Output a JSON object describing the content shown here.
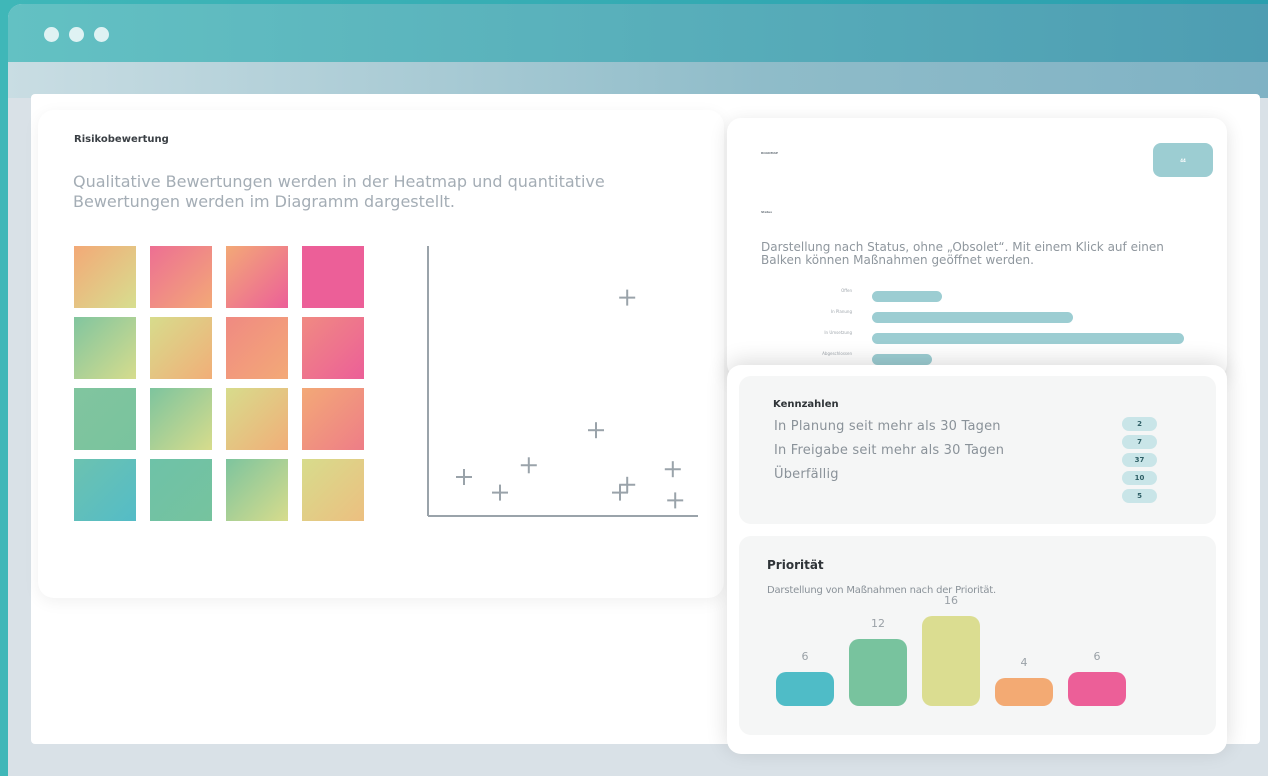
{
  "window": {
    "dots": [
      "dot",
      "dot",
      "dot"
    ]
  },
  "risk": {
    "title": "Risikobewertung",
    "description": "Qualitative Bewertungen werden in der Heatmap und quantitative Bewertungen werden im Diagramm dargestellt.",
    "heatmap_icon": "heatmap-grid",
    "scatter": {
      "type": "scatter",
      "points": [
        [
          1.5,
          1.0
        ],
        [
          3.0,
          0.6
        ],
        [
          4.2,
          1.3
        ],
        [
          7.0,
          2.2
        ],
        [
          8.3,
          5.6
        ],
        [
          8.0,
          0.6
        ],
        [
          8.3,
          0.8
        ],
        [
          10.2,
          1.2
        ],
        [
          10.3,
          0.4
        ]
      ]
    }
  },
  "status": {
    "header_label": "Status",
    "top_label": "ROADMAP",
    "button_label": "44",
    "description": "Darstellung nach Status, ohne „Obsolet“. Mit einem Klick auf einen Balken können Maßnahmen geöffnet werden.",
    "bars": [
      {
        "label": "Offen",
        "value": 7
      },
      {
        "label": "In Planung",
        "value": 20
      },
      {
        "label": "In Umsetzung",
        "value": 31
      },
      {
        "label": "Abgeschlossen",
        "value": 6
      }
    ]
  },
  "kennzahlen": {
    "title": "Kennzahlen",
    "items": [
      "In Planung seit mehr als 30 Tagen",
      "In Freigabe seit mehr als 30 Tagen",
      "Überfällig"
    ],
    "badges": [
      "2",
      "7",
      "37",
      "10",
      "5"
    ]
  },
  "prioritaet": {
    "title": "Priorität",
    "description": "Darstellung von Maßnahmen nach der Priorität.",
    "colors": [
      "#4fbcc7",
      "#78c39e",
      "#dbdd91",
      "#f3aa73",
      "#ec5f98"
    ]
  },
  "chart_data": {
    "type": "bar",
    "categories": [
      "",
      "",
      "",
      "",
      ""
    ],
    "values": [
      6,
      12,
      16,
      4,
      6
    ],
    "title": "Priorität",
    "xlabel": "",
    "ylabel": ""
  }
}
